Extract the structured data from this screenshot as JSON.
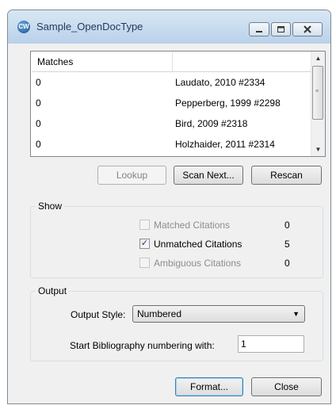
{
  "window": {
    "title": "Sample_OpenDocType"
  },
  "matches": {
    "header": "Matches",
    "rows": [
      {
        "count": "0",
        "citation": "Laudato, 2010 #2334"
      },
      {
        "count": "0",
        "citation": "Pepperberg, 1999 #2298"
      },
      {
        "count": "0",
        "citation": "Bird, 2009 #2318"
      },
      {
        "count": "0",
        "citation": "Holzhaider, 2011 #2314"
      }
    ]
  },
  "buttons": {
    "lookup": "Lookup",
    "scan_next": "Scan Next...",
    "rescan": "Rescan",
    "format": "Format...",
    "close": "Close"
  },
  "show": {
    "title": "Show",
    "matched": {
      "label": "Matched Citations",
      "count": "0",
      "checked": false,
      "enabled": false
    },
    "unmatched": {
      "label": "Unmatched Citations",
      "count": "5",
      "checked": true,
      "enabled": true
    },
    "ambiguous": {
      "label": "Ambiguous Citations",
      "count": "0",
      "checked": false,
      "enabled": false
    }
  },
  "output": {
    "title": "Output",
    "style_label": "Output Style:",
    "style_value": "Numbered",
    "numbering_label": "Start Bibliography numbering with:",
    "numbering_value": "1"
  },
  "icons": {
    "checkmark": "✓"
  }
}
